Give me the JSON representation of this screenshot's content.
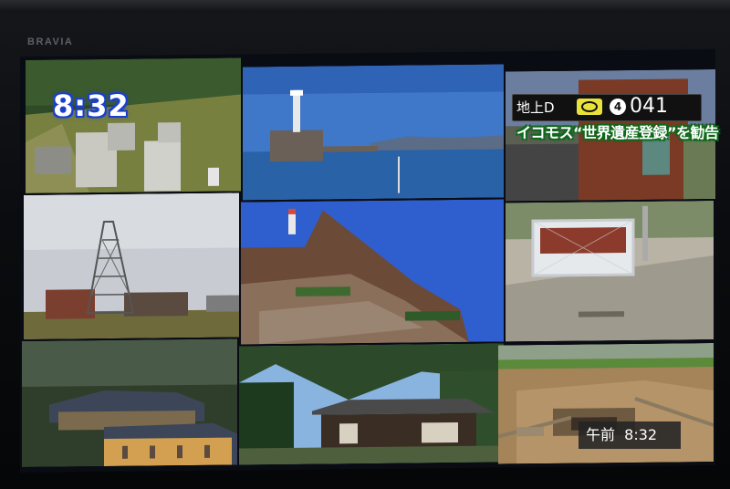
{
  "bezel": {
    "brand": "BRAVIA"
  },
  "overlay": {
    "clock": "8:32",
    "channel": {
      "source": "地上D",
      "guide_icon": "epg-guide-icon",
      "remote_key": "4",
      "number": "041"
    },
    "ticker": "イコモス“世界遺産登録”を勧告",
    "timestamp": "午前  8:32"
  },
  "tiles": [
    {
      "id": "ruins",
      "desc_colors": {
        "grass": "#6d7a3a",
        "stone": "#c9c9c2"
      }
    },
    {
      "id": "lighthouse",
      "desc_colors": {
        "sky": "#3f77c9",
        "sea": "#2a62a8"
      }
    },
    {
      "id": "brick-building",
      "desc_colors": {
        "brick": "#7a3a26"
      }
    },
    {
      "id": "headframe",
      "desc_colors": {
        "sky": "#c8ccd2"
      }
    },
    {
      "id": "island-fort",
      "desc_colors": {
        "sky": "#2f5fce",
        "rock": "#6b4a38"
      }
    },
    {
      "id": "fenced-pit",
      "desc_colors": {
        "pavement": "#b9b3a6",
        "fence": "#c8ccd0"
      }
    },
    {
      "id": "western-house",
      "desc_colors": {
        "roof": "#3c4658"
      }
    },
    {
      "id": "japanese-house",
      "desc_colors": {
        "sky": "#8ab4e0",
        "foliage": "#2c4a2a"
      }
    },
    {
      "id": "excavation",
      "desc_colors": {
        "soil": "#a48458"
      }
    }
  ]
}
